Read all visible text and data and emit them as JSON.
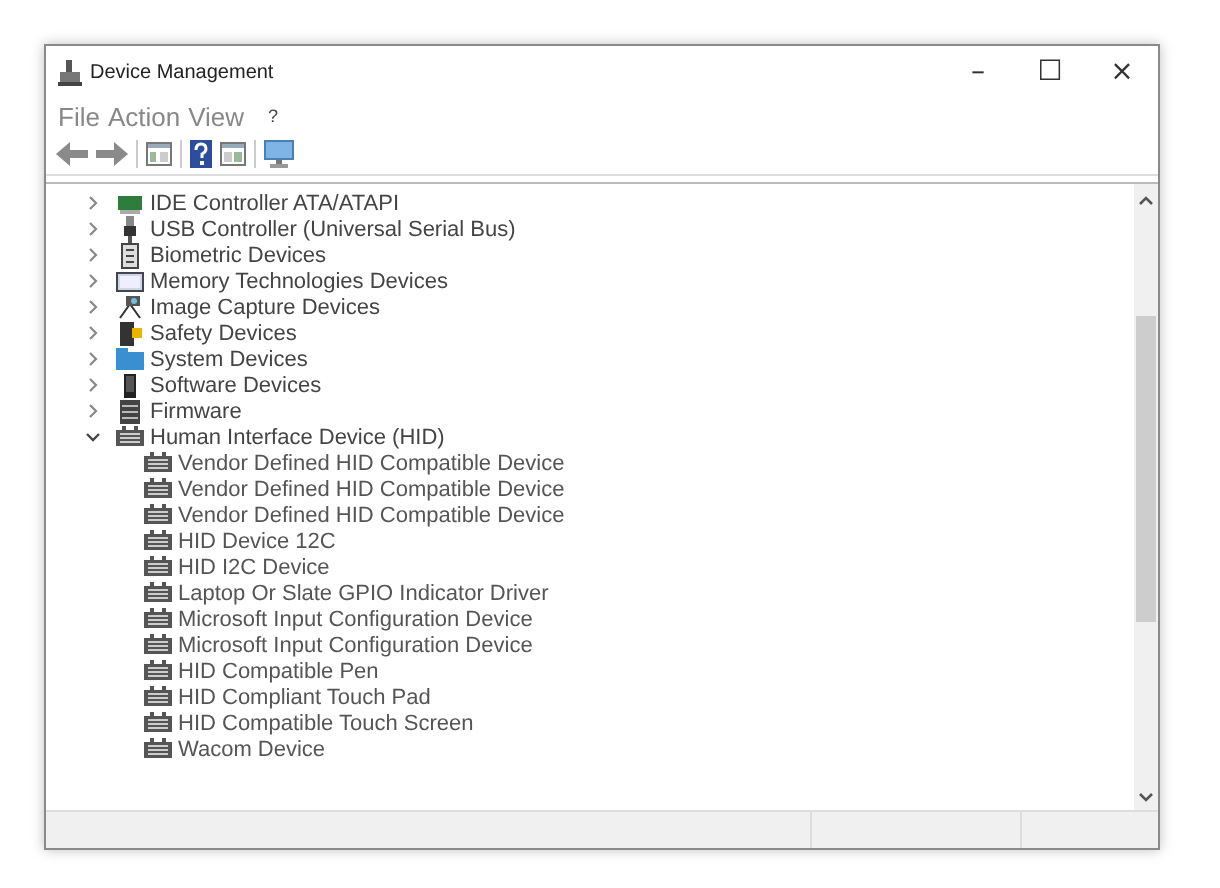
{
  "window": {
    "title": "Device Management",
    "controls": [
      "–",
      "☐",
      "×"
    ]
  },
  "menu": [
    "File",
    "Action",
    "View",
    "?"
  ],
  "tree": [
    {
      "label": "IDE Controller ATA/ATAPI",
      "kind": "ide",
      "expanded": false
    },
    {
      "label": "USB Controller (Universal Serial Bus)",
      "kind": "usb",
      "expanded": false
    },
    {
      "label": "Biometric Devices",
      "kind": "biometric",
      "expanded": false
    },
    {
      "label": "Memory Technologies Devices",
      "kind": "memory",
      "expanded": false
    },
    {
      "label": "Image Capture Devices",
      "kind": "camera",
      "expanded": false
    },
    {
      "label": "Safety Devices",
      "kind": "safety",
      "expanded": false
    },
    {
      "label": "System Devices",
      "kind": "system",
      "expanded": false
    },
    {
      "label": "Software Devices",
      "kind": "software",
      "expanded": false
    },
    {
      "label": "Firmware",
      "kind": "firmware",
      "expanded": false
    },
    {
      "label": "Human Interface Device (HID)",
      "kind": "hid",
      "expanded": true,
      "children": [
        {
          "label": "Vendor Defined HID Compatible Device",
          "kind": "hid"
        },
        {
          "label": "Vendor Defined HID Compatible Device",
          "kind": "hid"
        },
        {
          "label": "Vendor Defined HID Compatible Device",
          "kind": "hid"
        },
        {
          "label": "HID Device 12C",
          "kind": "hid"
        },
        {
          "label": "HID I2C Device",
          "kind": "hid"
        },
        {
          "label": "Laptop Or Slate GPIO Indicator Driver",
          "kind": "hid"
        },
        {
          "label": "Microsoft Input Configuration Device",
          "kind": "hid"
        },
        {
          "label": "Microsoft Input Configuration Device",
          "kind": "hid"
        },
        {
          "label": "HID Compatible Pen",
          "kind": "hid"
        },
        {
          "label": "HID Compliant Touch Pad",
          "kind": "hid"
        },
        {
          "label": "HID Compatible Touch Screen",
          "kind": "hid"
        },
        {
          "label": "Wacom Device",
          "kind": "hid"
        }
      ]
    }
  ]
}
